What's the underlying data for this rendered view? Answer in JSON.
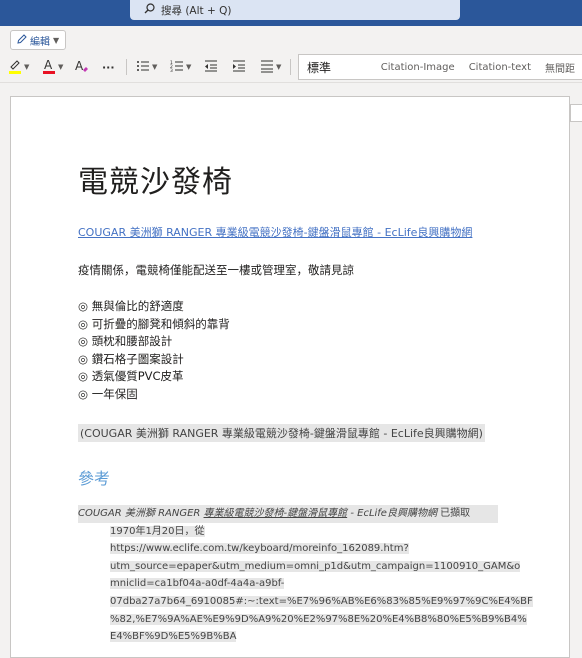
{
  "search": {
    "placeholder": "搜尋 (Alt + Q)"
  },
  "ribbon": {
    "edit_label": "編輯"
  },
  "toolbar": {
    "more": "···",
    "styles": {
      "normal": "標準",
      "citation_image": "Citation-Image",
      "citation_text": "Citation-text",
      "no_spacing": "無間距"
    }
  },
  "document": {
    "title": "電競沙發椅",
    "link": "COUGAR 美洲獅 RANGER 專業級電競沙發椅-鍵盤滑鼠專館 - EcLife良興購物網",
    "notice": "疫情關係，電競椅僅能配送至一樓或管理室，敬請見諒",
    "bullets": [
      "◎ 無與倫比的舒適度",
      "◎ 可折疊的腳凳和傾斜的靠背",
      "◎ 頭枕和腰部設計",
      "◎ 鑽石格子圖案設計",
      "◎ 透氣優質PVC皮革",
      "◎ 一年保固"
    ],
    "inline_citation": "(COUGAR 美洲獅 RANGER 專業級電競沙發椅-鍵盤滑鼠專館 - EcLife良興購物網)",
    "references_heading": "參考",
    "reference": {
      "author": "COUGAR 美洲獅 RANGER ",
      "title": "專業級電競沙發椅-鍵盤滑鼠專館",
      "site": " - EcLife良興購物網",
      "retrieved": " 已擷取",
      "lines": [
        "1970年1月20日，從 https://www.eclife.com.tw/keyboard/moreinfo_162089.htm?",
        "utm_source=epaper&utm_medium=omni_p1d&utm_campaign=1100910_GAM&o",
        "mniclid=ca1bf04a-a0df-4a4a-a9bf-",
        "07dba27a7b64_6910085#:~:text=%E7%96%AB%E6%83%85%E9%97%9C%E4%BF",
        "%82,%E7%9A%AE%E9%9D%A9%20%E2%97%8E%20%E4%B8%80%E5%B9%B4%",
        "E4%BF%9D%E5%9B%BA"
      ]
    }
  }
}
